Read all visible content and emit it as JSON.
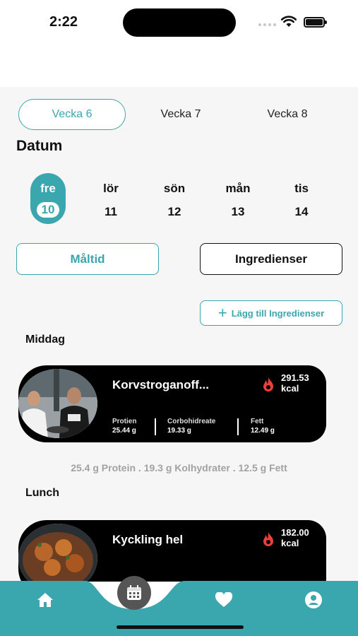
{
  "status": {
    "time": "2:22"
  },
  "weeks": [
    "Vecka 6",
    "Vecka 7",
    "Vecka 8"
  ],
  "date_heading": "Datum",
  "days": [
    {
      "name": "fre",
      "num": "10"
    },
    {
      "name": "lör",
      "num": "11"
    },
    {
      "name": "sön",
      "num": "12"
    },
    {
      "name": "mån",
      "num": "13"
    },
    {
      "name": "tis",
      "num": "14"
    }
  ],
  "segments": {
    "maltid": "Måltid",
    "ingredienser": "Ingredienser"
  },
  "add_button": {
    "label": "Lägg till Ingredienser"
  },
  "sections": {
    "middag": "Middag",
    "lunch": "Lunch"
  },
  "meals": [
    {
      "title": "Korvstroganoff...",
      "kcal_value": "291.53",
      "kcal_unit": "kcal",
      "macros": [
        {
          "label": "Protien",
          "value": "25.44 g"
        },
        {
          "label": "Corbohidreate",
          "value": "19.33 g"
        },
        {
          "label": "Fett",
          "value": "12.49 g"
        }
      ]
    },
    {
      "title": "Kyckling hel",
      "kcal_value": "182.00",
      "kcal_unit": "kcal"
    }
  ],
  "summary": "25.4 g Protein . 19.3 g  Kolhydrater . 12.5 g Fett",
  "colors": {
    "accent": "#3aa7ae",
    "card": "#000000",
    "flame": "#e8413a"
  },
  "nav": [
    "home-icon",
    "calendar-icon",
    "heart-icon",
    "profile-icon"
  ]
}
